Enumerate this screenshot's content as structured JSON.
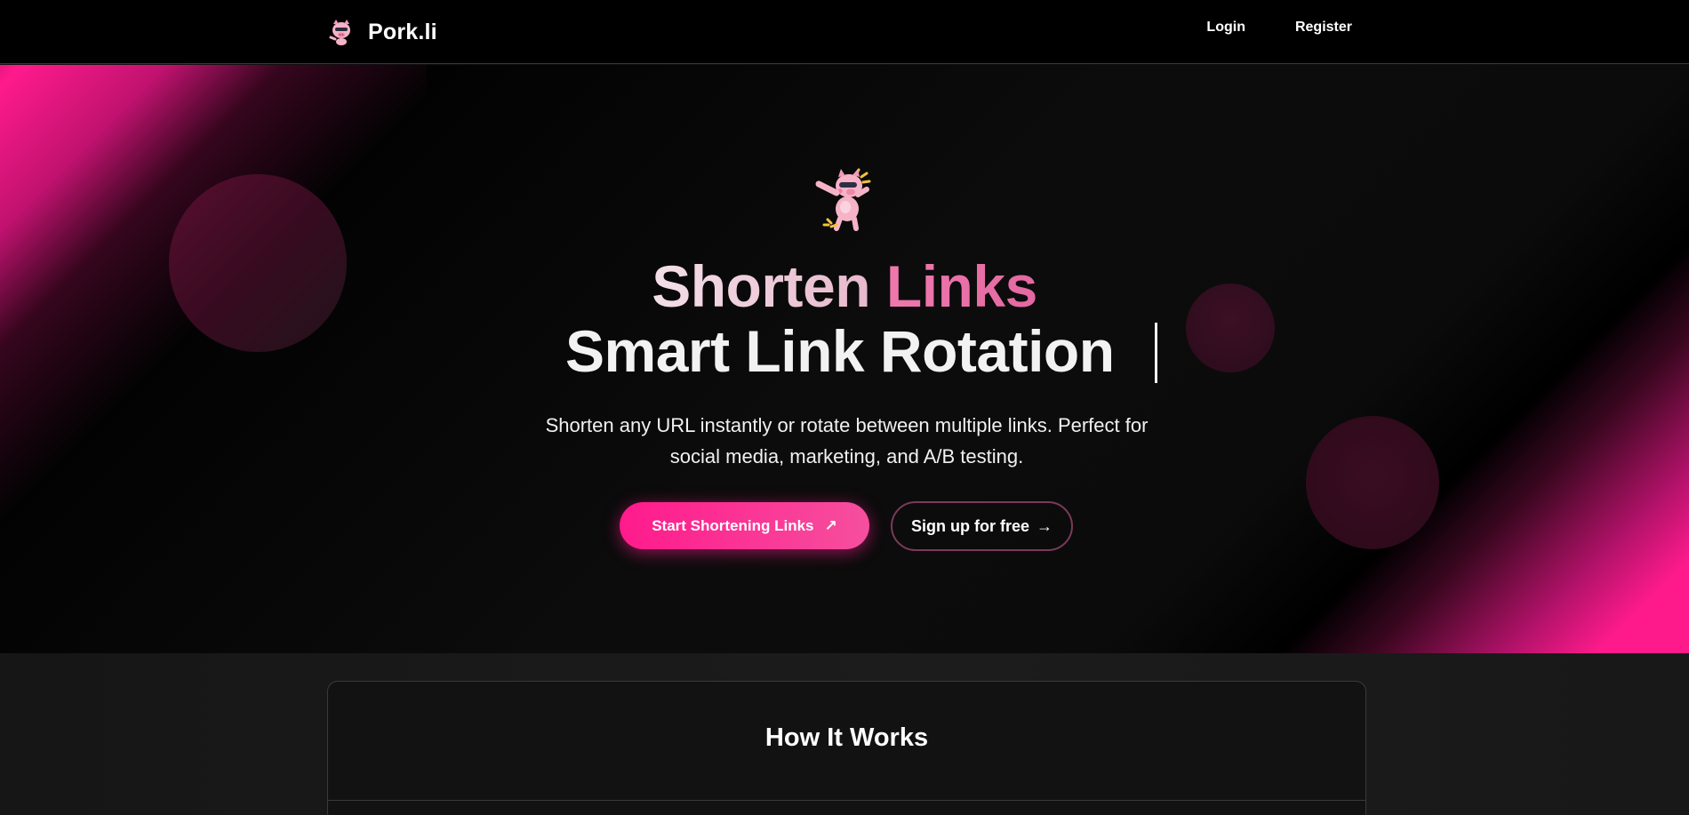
{
  "navbar": {
    "brand_name": "Pork.li",
    "logo_icon": "pig-mascot-icon",
    "links": {
      "login": "Login",
      "register": "Register"
    }
  },
  "hero": {
    "mascot_icon": "dabbing-pig-icon",
    "title_word_1": "Shorten",
    "title_word_2": "Links",
    "title_line_2": "Smart Link Rotation",
    "subtitle": "Shorten any URL instantly or rotate between multiple links. Perfect for social media, marketing, and A/B testing.",
    "primary_button": {
      "label": "Start Shortening Links",
      "icon": "arrow-up-right-icon",
      "glyph": "↗"
    },
    "secondary_button": {
      "label": "Sign up for free",
      "icon": "arrow-right-icon",
      "glyph": "→"
    }
  },
  "how_it_works": {
    "title": "How It Works"
  },
  "colors": {
    "accent": "#ff1a8c",
    "accent_soft": "#ee79ad",
    "background": "#000000",
    "surface": "#121212"
  }
}
